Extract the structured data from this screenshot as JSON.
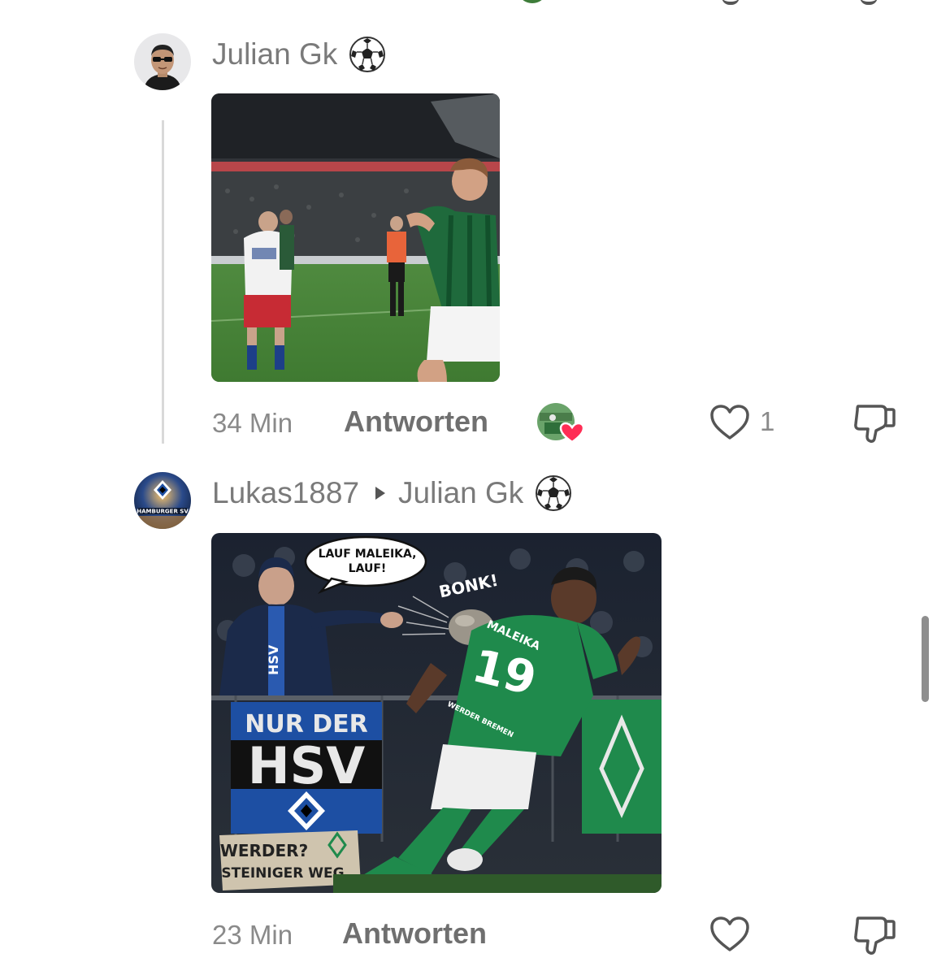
{
  "comments": [
    {
      "author": "Julian Gk",
      "author_badge_icon": "soccer-ball-icon",
      "avatar_icon": "avatar-man-sunglasses",
      "media": "gif-football-match",
      "time": "34 Min",
      "reply_label": "Antworten",
      "creator_liked": true,
      "like_count": "1"
    },
    {
      "author": "Lukas1887",
      "reply_to": "Julian Gk",
      "reply_to_badge_icon": "soccer-ball-icon",
      "avatar_icon": "avatar-hamburger-sv-stadium",
      "avatar_text": "HAMBURGER SV",
      "media": "meme-image",
      "meme": {
        "speech": "LAUF MALEIKA, LAUF!",
        "sound": "BONK!",
        "player_name": "MALEIKA",
        "player_number": "19",
        "club_text": "WERDER BREMEN",
        "banner_top": "NUR DER",
        "banner_main": "HSV",
        "scarf_text": "HSV",
        "sign_line1": "WERDER?",
        "sign_line2": "STEINIGER WEG"
      },
      "time": "23 Min",
      "reply_label": "Antworten",
      "like_count": ""
    }
  ],
  "colors": {
    "like_heart": "#ff2d55",
    "text_muted": "#8a8a8a",
    "werder_green": "#1f8a4c",
    "hsv_blue": "#1d4fa3"
  }
}
